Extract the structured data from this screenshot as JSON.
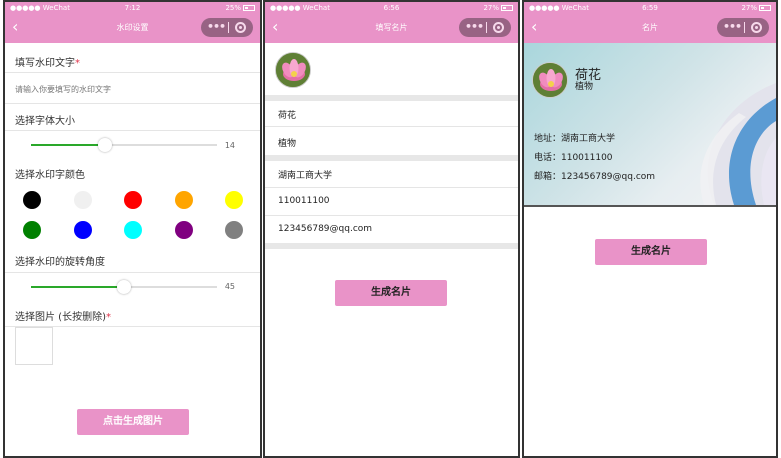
{
  "common": {
    "carrier": "●●●●● WeChat",
    "battery_icon": "battery-icon",
    "accent_color": "#e993c8"
  },
  "screen1": {
    "status_time": "7:12",
    "battery": "25%",
    "title": "水印设置",
    "watermark_text_label": "填写水印文字",
    "required_mark": "*",
    "watermark_text_placeholder": "请输入你要填写的水印文字",
    "font_size_label": "选择字体大小",
    "font_size_value": "14",
    "font_size_fraction": 0.4,
    "color_label": "选择水印字颜色",
    "colors": [
      "#000000",
      "#f0f0f0",
      "#ff0000",
      "#ffa500",
      "#ffff00",
      "#008000",
      "#0000ff",
      "#00ffff",
      "#800080",
      "#808080"
    ],
    "rotation_label": "选择水印的旋转角度",
    "rotation_value": "45",
    "rotation_fraction": 0.5,
    "image_label": "选择图片 (长按删除)",
    "generate_button": "点击生成图片"
  },
  "screen2": {
    "status_time": "6:56",
    "battery": "27%",
    "title": "填写名片",
    "name_value": "荷花",
    "category_value": "植物",
    "address_value": "湖南工商大学",
    "phone_value": "110011100",
    "email_value": "123456789@qq.com",
    "generate_button": "生成名片"
  },
  "screen3": {
    "status_time": "6:59",
    "battery": "27%",
    "title": "名片",
    "card_name": "荷花",
    "card_category": "植物",
    "address_line": "地址：湖南工商大学",
    "phone_line": "电话：110011100",
    "email_line": "邮箱：123456789@qq.com",
    "generate_button": "生成名片"
  }
}
